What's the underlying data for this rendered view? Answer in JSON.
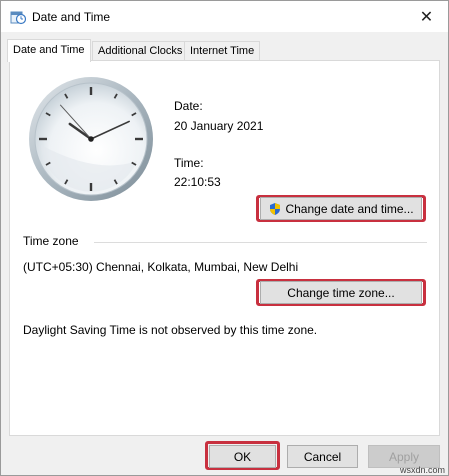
{
  "window": {
    "title": "Date and Time",
    "close_glyph": "✕"
  },
  "tabs": [
    {
      "label": "Date and Time",
      "active": true
    },
    {
      "label": "Additional Clocks",
      "active": false
    },
    {
      "label": "Internet Time",
      "active": false
    }
  ],
  "date_time": {
    "date_label": "Date:",
    "date_value": "20 January 2021",
    "time_label": "Time:",
    "time_value": "22:10:53",
    "clock": {
      "hour": 22,
      "minute": 10,
      "second": 53
    },
    "change_button": "Change date and time...",
    "change_button_icon": "uac-shield-icon"
  },
  "time_zone": {
    "section_label": "Time zone",
    "value": "(UTC+05:30) Chennai, Kolkata, Mumbai, New Delhi",
    "change_button": "Change time zone...",
    "dst_note": "Daylight Saving Time is not observed by this time zone."
  },
  "footer": {
    "ok": "OK",
    "cancel": "Cancel",
    "apply": "Apply"
  },
  "annotations": {
    "highlight_color": "#c8303f"
  },
  "watermark": "wsxdn.com"
}
